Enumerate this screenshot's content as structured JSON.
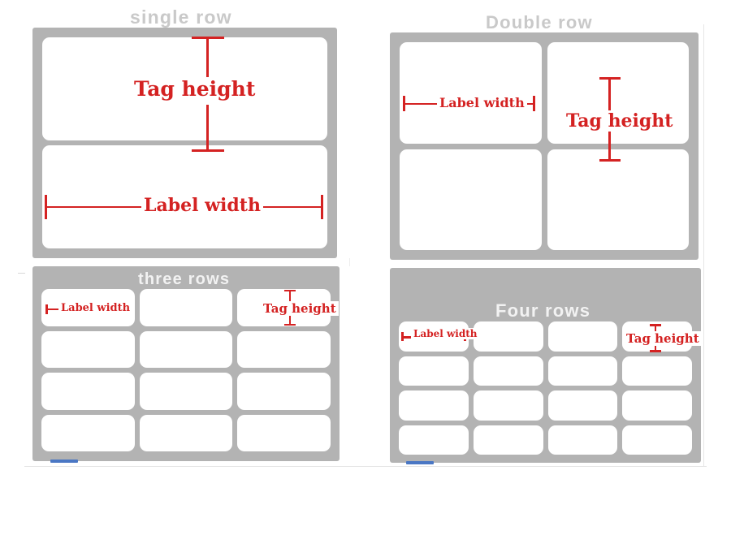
{
  "figure": {
    "description": "Label layout diagram showing four sheet configurations with label width and tag height dimension callouts",
    "background_color": "#ffffff",
    "panel_color": "#b3b3b3",
    "label_color": "#ffffff",
    "annotation_color": "#d42222",
    "title_outside_color": "#c9c9c9",
    "title_inside_color": "#f2f2f2",
    "scroll_nub_color": "#4a77c4"
  },
  "panels": [
    {
      "id": "single-row",
      "title": "single row",
      "title_placement": "above",
      "columns": 1,
      "rows": 2,
      "annotations": [
        {
          "kind": "tag-height",
          "label": "Tag height",
          "orientation": "vertical",
          "cell_index": 0
        },
        {
          "kind": "label-width",
          "label": "Label width",
          "orientation": "horizontal",
          "cell_index": 1
        }
      ]
    },
    {
      "id": "double-row",
      "title": "Double row",
      "title_placement": "above",
      "columns": 2,
      "rows": 2,
      "annotations": [
        {
          "kind": "label-width",
          "label": "Label width",
          "orientation": "horizontal",
          "cell_index": 0
        },
        {
          "kind": "tag-height",
          "label": "Tag height",
          "orientation": "vertical",
          "cell_index": 1
        }
      ]
    },
    {
      "id": "three-rows",
      "title": "three rows",
      "title_placement": "inside",
      "columns": 3,
      "rows": 4,
      "annotations": [
        {
          "kind": "label-width",
          "label": "Label width",
          "orientation": "horizontal",
          "cell_index": 0
        },
        {
          "kind": "tag-height",
          "label": "Tag height",
          "orientation": "vertical",
          "cell_index": 2
        }
      ]
    },
    {
      "id": "four-rows",
      "title": "Four rows",
      "title_placement": "inside",
      "columns": 4,
      "rows": 4,
      "annotations": [
        {
          "kind": "label-width",
          "label": "Label width",
          "orientation": "horizontal",
          "cell_index": 0
        },
        {
          "kind": "tag-height",
          "label": "Tag height",
          "orientation": "vertical",
          "cell_index": 3
        }
      ]
    }
  ]
}
